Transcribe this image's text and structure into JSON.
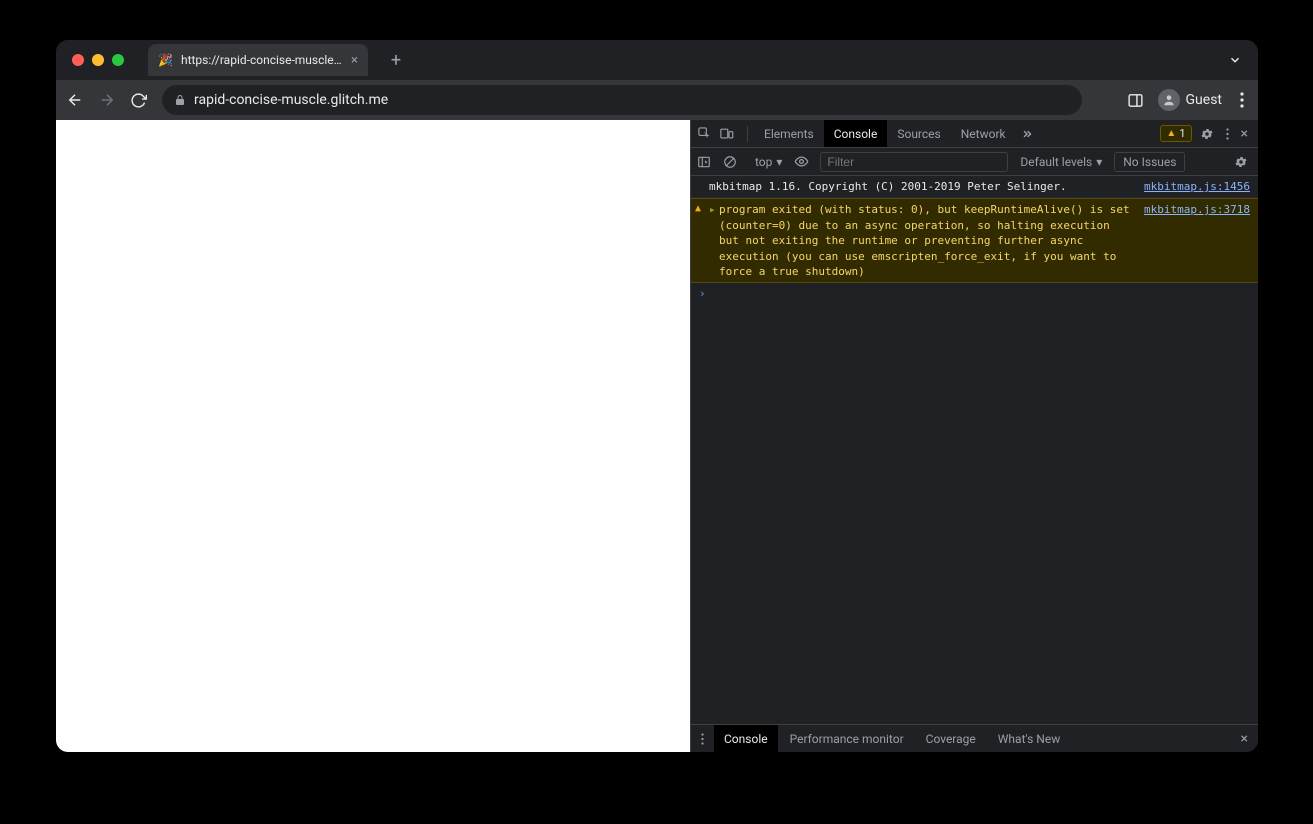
{
  "tab": {
    "favicon": "🎉",
    "title": "https://rapid-concise-muscle.g"
  },
  "toolbar": {
    "url": "rapid-concise-muscle.glitch.me",
    "profile_label": "Guest"
  },
  "devtools": {
    "tabs": [
      "Elements",
      "Console",
      "Sources",
      "Network"
    ],
    "active_tab": "Console",
    "warn_count": "1",
    "console_toolbar": {
      "context": "top",
      "filter_placeholder": "Filter",
      "levels_label": "Default levels",
      "issues_label": "No Issues"
    },
    "logs": [
      {
        "type": "log",
        "message": "mkbitmap 1.16. Copyright (C) 2001-2019 Peter Selinger.",
        "source": "mkbitmap.js:1456"
      },
      {
        "type": "warn",
        "message": "program exited (with status: 0), but keepRuntimeAlive() is set (counter=0) due to an async operation, so halting execution but not exiting the runtime or preventing further async execution (you can use emscripten_force_exit, if you want to force a true shutdown)",
        "source": "mkbitmap.js:3718"
      }
    ],
    "drawer_tabs": [
      "Console",
      "Performance monitor",
      "Coverage",
      "What's New"
    ],
    "drawer_active": "Console"
  }
}
